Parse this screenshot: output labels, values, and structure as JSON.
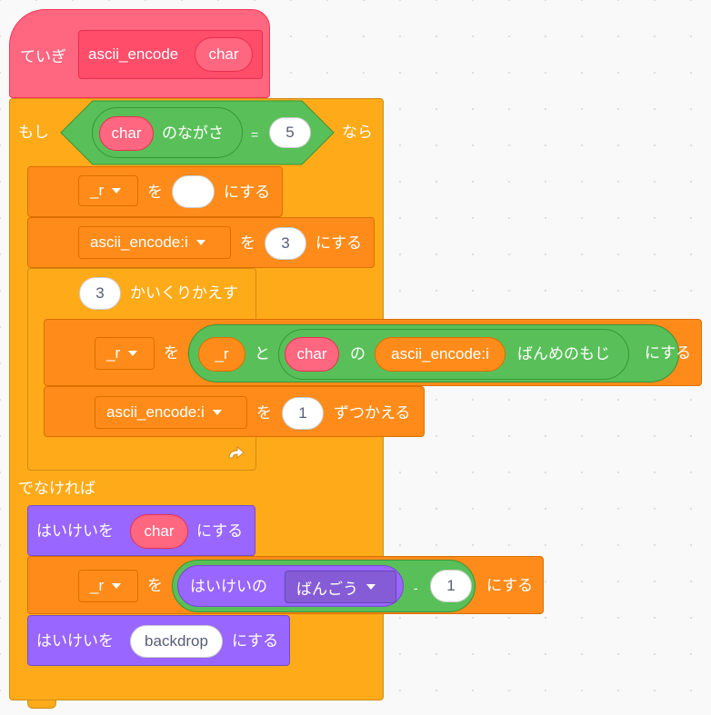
{
  "define": {
    "keyword": "ていぎ",
    "name": "ascii_encode",
    "param": "char"
  },
  "if_else": {
    "if_label": "もし",
    "then_label": "なら",
    "else_label": "でなければ",
    "condition": {
      "reporter": "char",
      "length_label": "のながさ",
      "operator": "=",
      "value": "5"
    }
  },
  "set_label": "にする",
  "to_label": "を",
  "blocks": {
    "set_r": {
      "variable": "_r",
      "value": ""
    },
    "set_i": {
      "variable": "ascii_encode:i",
      "value": "3"
    },
    "repeat": {
      "times": "3",
      "label": "かいくりかえす"
    },
    "set_r_join": {
      "variable": "_r",
      "join_left": "_r",
      "join_word": "と",
      "letter_of_string": "char",
      "of_word": "の",
      "letter_index": "ascii_encode:i",
      "letter_suffix": "ばんめのもじ"
    },
    "change_i": {
      "variable": "ascii_encode:i",
      "amount": "1",
      "label": "ずつかえる"
    },
    "switch_costume": {
      "label": "はいけいを",
      "value": "char"
    },
    "set_r_backdrop": {
      "variable": "_r",
      "backdrop_label": "はいけいの",
      "property": "ばんごう",
      "operator": "-",
      "value": "1"
    },
    "switch_backdrop": {
      "label": "はいけいを",
      "value": "backdrop"
    }
  },
  "colors": {
    "custom": "#ff6680",
    "control": "#ffab19",
    "variables": "#ff8c1a",
    "looks": "#9966ff",
    "operators": "#59c059"
  },
  "icons": {
    "repeat_arrow": "loop-arrow-icon",
    "dropdown": "caret-down-icon"
  }
}
